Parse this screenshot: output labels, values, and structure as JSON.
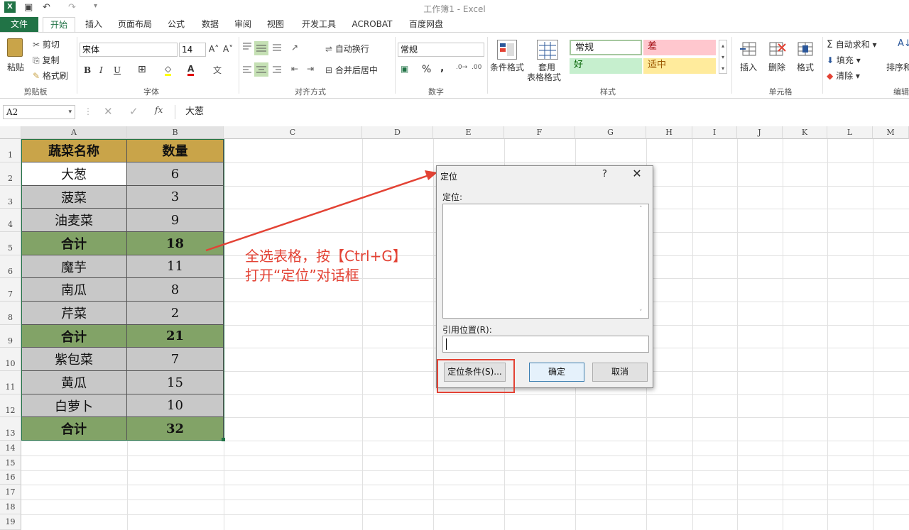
{
  "titlebar": {
    "title": "工作簿1 - Excel"
  },
  "tabs": [
    "文件",
    "开始",
    "插入",
    "页面布局",
    "公式",
    "数据",
    "审阅",
    "视图",
    "开发工具",
    "ACROBAT",
    "百度网盘"
  ],
  "ribbon": {
    "clipboard": {
      "paste": "粘贴",
      "cut": "剪切",
      "copy": "复制",
      "format_painter": "格式刷",
      "label": "剪贴板"
    },
    "font": {
      "name": "宋体",
      "size": "14",
      "bold": "B",
      "italic": "I",
      "underline": "U",
      "label": "字体"
    },
    "alignment": {
      "wrap": "自动换行",
      "merge": "合并后居中",
      "label": "对齐方式"
    },
    "number": {
      "format": "常规",
      "percent": "%",
      "comma": ",",
      "label": "数字"
    },
    "styles": {
      "conditional": "条件格式",
      "table_style_1": "套用",
      "table_style_2": "表格格式",
      "normal": "常规",
      "bad": "差",
      "good": "好",
      "neutral": "适中",
      "label": "样式"
    },
    "cells": {
      "insert": "插入",
      "delete": "删除",
      "format": "格式",
      "label": "单元格"
    },
    "editing": {
      "autosum": "自动求和",
      "fill": "填充",
      "clear": "清除",
      "sort": "排序和",
      "label": "编辑"
    }
  },
  "formulabar": {
    "namebox": "A2",
    "fx": "fx",
    "value": "大葱"
  },
  "columns": [
    "A",
    "B",
    "C",
    "D",
    "E",
    "F",
    "G",
    "H",
    "I",
    "J",
    "K",
    "L",
    "M"
  ],
  "rows": [
    "1",
    "2",
    "3",
    "4",
    "5",
    "6",
    "7",
    "8",
    "9",
    "10",
    "11",
    "12",
    "13",
    "14",
    "15",
    "16",
    "17",
    "18",
    "19"
  ],
  "table": {
    "header": [
      "蔬菜名称",
      "数量"
    ],
    "rows": [
      [
        "大葱",
        "6"
      ],
      [
        "菠菜",
        "3"
      ],
      [
        "油麦菜",
        "9"
      ],
      [
        "合计",
        "18"
      ],
      [
        "魔芋",
        "11"
      ],
      [
        "南瓜",
        "8"
      ],
      [
        "芹菜",
        "2"
      ],
      [
        "合计",
        "21"
      ],
      [
        "紫包菜",
        "7"
      ],
      [
        "黄瓜",
        "15"
      ],
      [
        "白萝卜",
        "10"
      ],
      [
        "合计",
        "32"
      ]
    ]
  },
  "annotation": {
    "line1": "全选表格，按【Ctrl+G】",
    "line2": "打开“定位”对话框"
  },
  "dialog": {
    "title": "定位",
    "help": "?",
    "close": "✕",
    "goto_label": "定位:",
    "ref_label": "引用位置(R):",
    "special_button": "定位条件(S)...",
    "ok_button": "确定",
    "cancel_button": "取消"
  }
}
